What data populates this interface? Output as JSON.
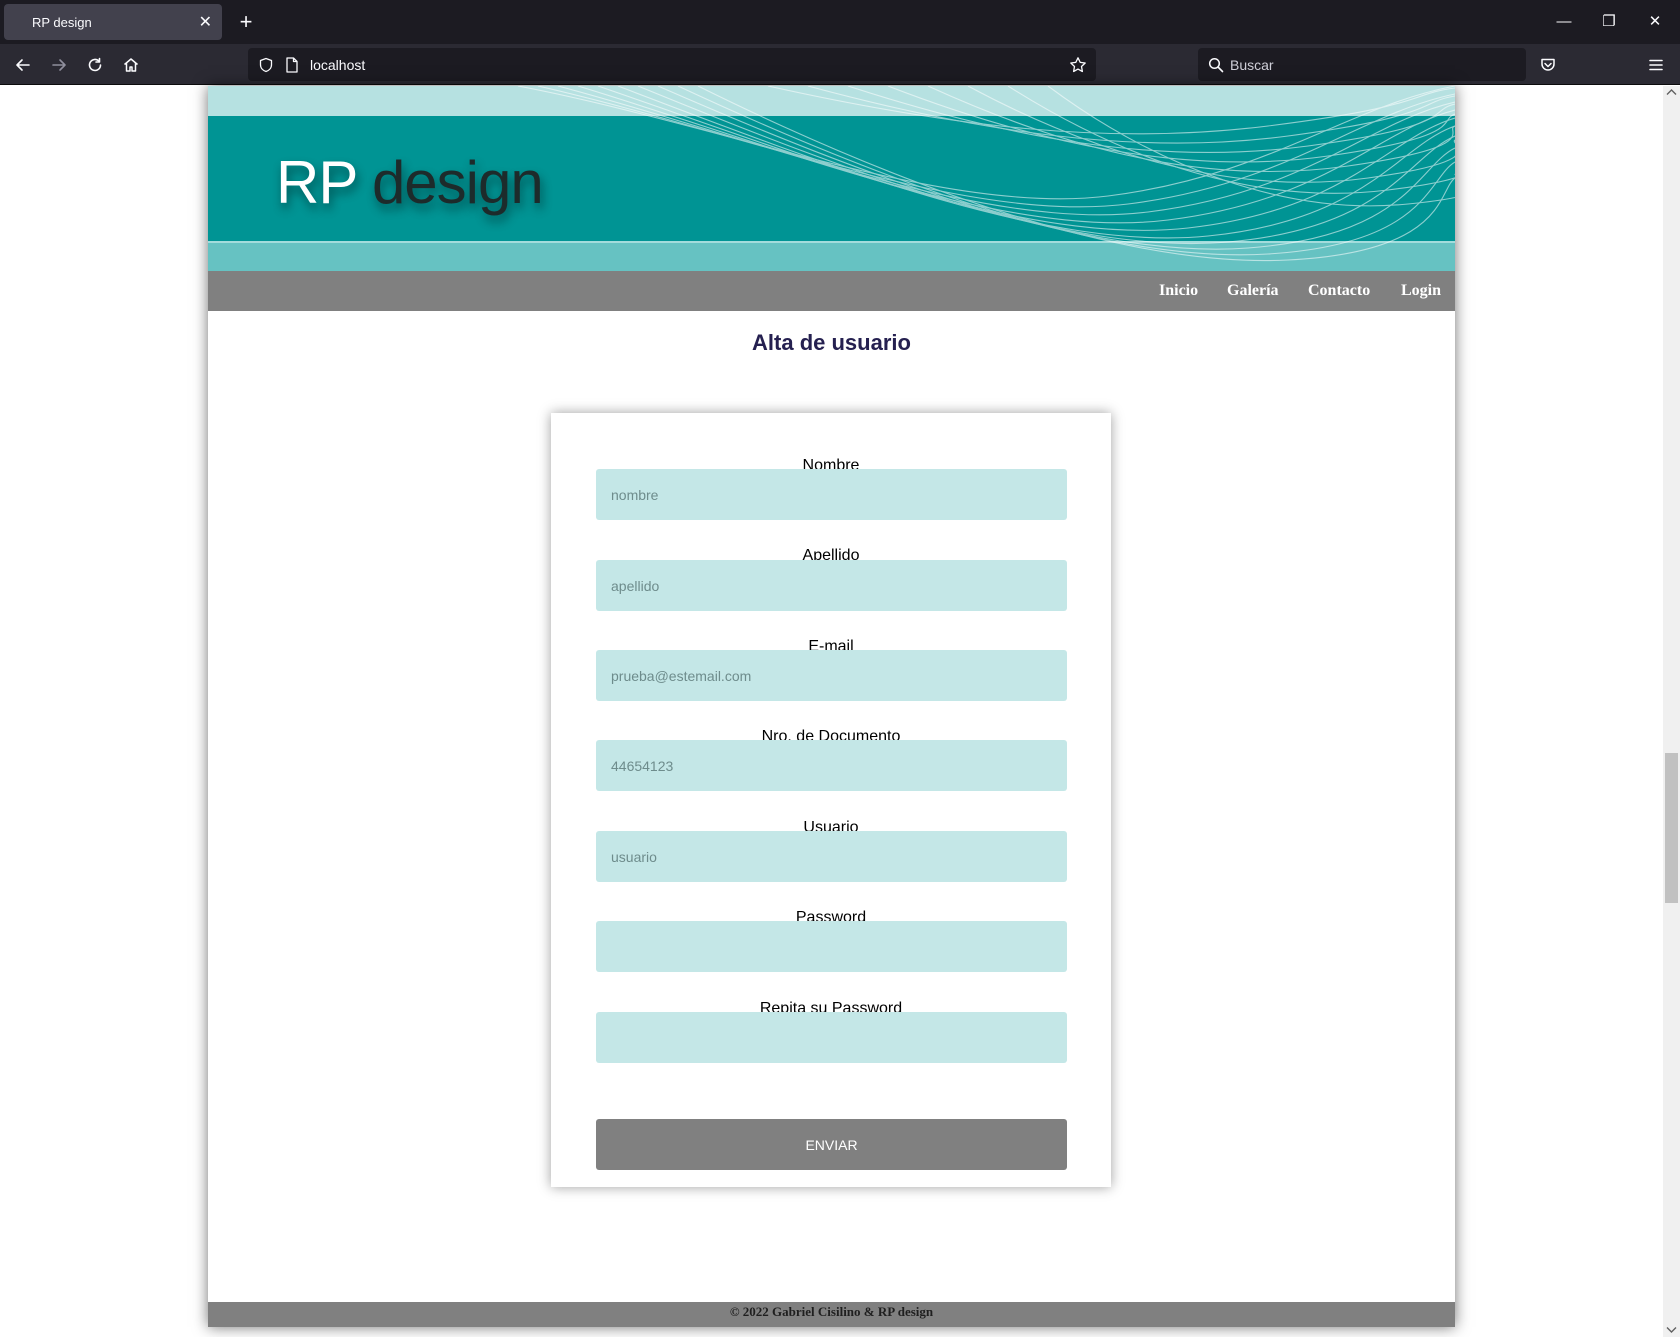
{
  "browser": {
    "tab_title": "RP design",
    "tab_close": "✕",
    "new_tab": "+",
    "url": "localhost",
    "search_placeholder": "Buscar",
    "window_controls": {
      "minimize": "—",
      "restore": "❐",
      "close": "✕"
    }
  },
  "header": {
    "logo_rp": "RP",
    "logo_design": "design"
  },
  "menu": {
    "items": [
      {
        "label": "Inicio"
      },
      {
        "label": "Galería"
      },
      {
        "label": "Contacto"
      },
      {
        "label": "Login"
      }
    ]
  },
  "main": {
    "title": "Alta de usuario"
  },
  "form": {
    "fields": [
      {
        "label": "Nombre",
        "placeholder": "nombre"
      },
      {
        "label": "Apellido",
        "placeholder": "apellido"
      },
      {
        "label": "E-mail",
        "placeholder": "prueba@estemail.com"
      },
      {
        "label": "Nro. de Documento",
        "placeholder": "44654123"
      },
      {
        "label": "Usuario",
        "placeholder": "usuario"
      },
      {
        "label": "Password",
        "placeholder": ""
      },
      {
        "label": "Repita su Password",
        "placeholder": ""
      }
    ],
    "submit_label": "ENVIAR"
  },
  "footer": {
    "text": "© 2022 Gabriel Cisilino & RP design"
  },
  "colors": {
    "header_teal": "#009494",
    "header_light": "#b6e1e1",
    "header_strip": "#66c2c2",
    "menu_gray": "#808080",
    "input_bg": "#c4e7e7",
    "title_color": "#252050"
  }
}
